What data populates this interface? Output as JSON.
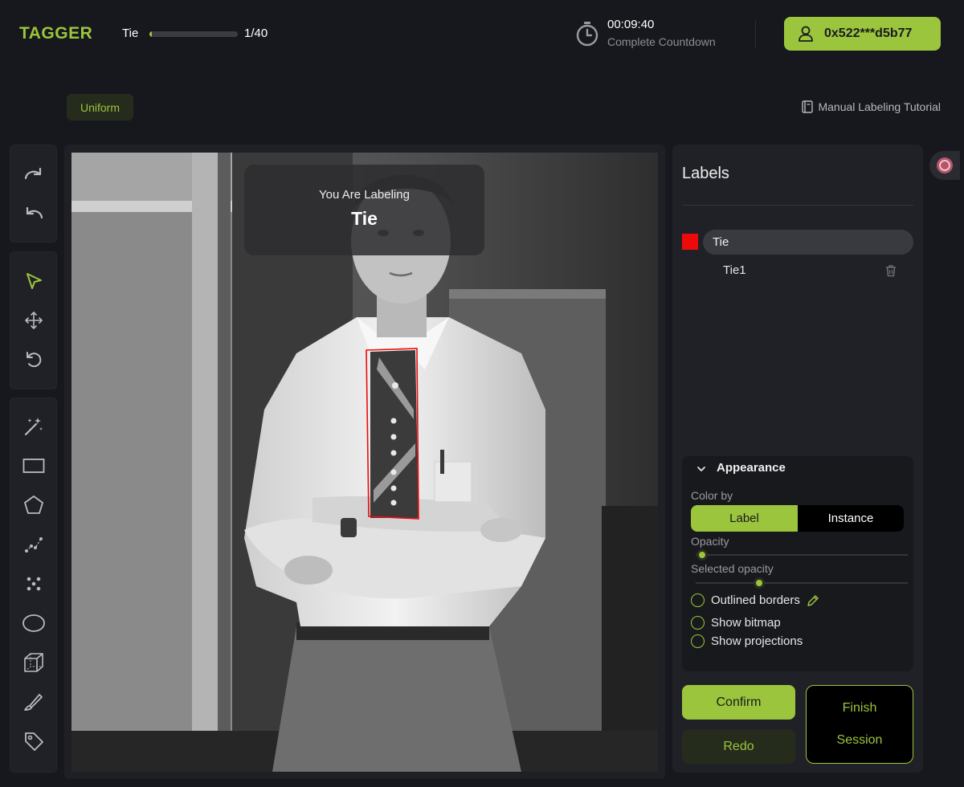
{
  "header": {
    "logo": "TAGGER",
    "task_name": "Tie",
    "progress_fraction": 0.03,
    "progress_text": "1/40",
    "timer_time": "00:09:40",
    "timer_label": "Complete Countdown",
    "wallet_address": "0x522***d5b77"
  },
  "toolbar": {
    "category_tag": "Uniform",
    "tutorial_link": "Manual Labeling Tutorial"
  },
  "tools": {
    "history": [
      "redo-icon",
      "undo-icon"
    ],
    "navigation": [
      "select-arrow-icon",
      "move-icon",
      "rotate-icon"
    ],
    "drawing": [
      "magic-wand-icon",
      "rectangle-icon",
      "polygon-icon",
      "polyline-icon",
      "points-icon",
      "ellipse-icon",
      "cuboid-icon",
      "brush-icon",
      "tag-icon"
    ]
  },
  "canvas": {
    "banner_subtitle": "You Are Labeling",
    "banner_title": "Tie"
  },
  "labels_panel": {
    "title": "Labels",
    "label": {
      "name": "Tie",
      "color": "#ee0a0a"
    },
    "instances": [
      "Tie1"
    ]
  },
  "appearance": {
    "title": "Appearance",
    "color_by_label": "Color by",
    "color_by_options": [
      "Label",
      "Instance"
    ],
    "color_by_selected": "Label",
    "opacity_label": "Opacity",
    "opacity_value": 0.03,
    "selected_opacity_label": "Selected opacity",
    "selected_opacity_value": 0.3,
    "checkboxes": [
      "Outlined borders",
      "Show bitmap",
      "Show projections"
    ]
  },
  "actions": {
    "confirm": "Confirm",
    "redo": "Redo",
    "finish_line1": "Finish",
    "finish_line2": "Session"
  },
  "colors": {
    "accent": "#9bc53d",
    "background": "#17181d",
    "panel": "#202126",
    "label_red": "#ee0a0a"
  }
}
